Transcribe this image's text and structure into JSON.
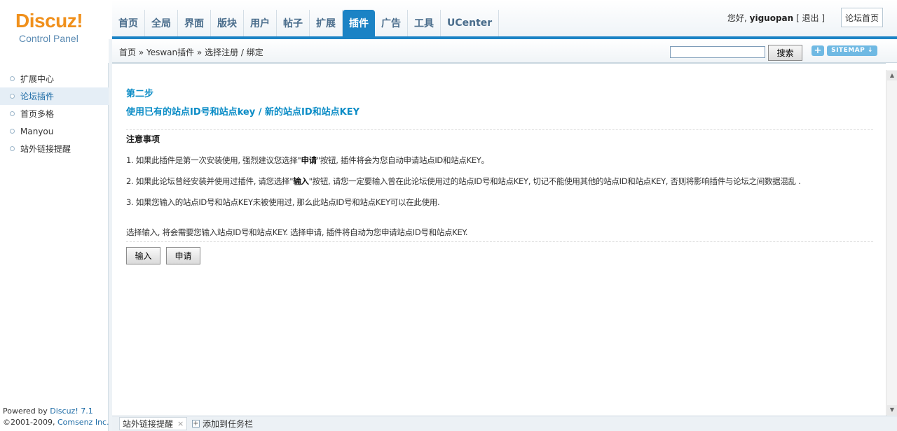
{
  "logo": {
    "brand": "Discuz!",
    "subtitle": "Control Panel"
  },
  "nav": {
    "tabs": [
      {
        "label": "首页"
      },
      {
        "label": "全局"
      },
      {
        "label": "界面"
      },
      {
        "label": "版块"
      },
      {
        "label": "用户"
      },
      {
        "label": "帖子"
      },
      {
        "label": "扩展"
      },
      {
        "label": "插件",
        "active": true
      },
      {
        "label": "广告"
      },
      {
        "label": "工具"
      },
      {
        "label": "UCenter"
      }
    ]
  },
  "user": {
    "greeting": "您好, ",
    "username": "yiguopan",
    "logout_open": " [ ",
    "logout": "退出",
    "logout_close": " ]",
    "home_button": "论坛首页"
  },
  "breadcrumb": "首页 » Yeswan插件 » 选择注册 / 绑定",
  "search": {
    "value": "",
    "button": "搜索",
    "plus": "+",
    "sitemap": "SITEMAP ↓"
  },
  "sidebar": {
    "items": [
      {
        "label": "扩展中心"
      },
      {
        "label": "论坛插件",
        "active": true
      },
      {
        "label": "首页多格"
      },
      {
        "label": "Manyou"
      },
      {
        "label": "站外链接提醒"
      }
    ],
    "footer": {
      "powered_prefix": "Powered by ",
      "powered_link": "Discuz! 7.1",
      "copyright_prefix": "©2001-2009, ",
      "copyright_link": "Comsenz Inc."
    }
  },
  "content": {
    "step_title": "第二步",
    "step_subtitle": "使用已有的站点ID号和站点key / 新的站点ID和站点KEY",
    "notice_title": "注意事项",
    "notice1": {
      "pre": "1. 如果此插件是第一次安装使用, 强烈建议您选择\"",
      "bold": "申请",
      "post": "\"按钮, 插件将会为您自动申请站点ID和站点KEY。"
    },
    "notice2": {
      "pre": "2. 如果此论坛曾经安装并使用过插件, 请您选择\"",
      "bold": "输入",
      "post": "\"按钮, 请您一定要输入曾在此论坛使用过的站点ID号和站点KEY, 切记不能使用其他的站点ID和站点KEY, 否则将影响插件与论坛之间数据混乱 ."
    },
    "notice3": "3. 如果您输入的站点ID号和站点KEY未被使用过, 那么此站点ID号和站点KEY可以在此使用.",
    "summary": "选择输入, 将会需要您输入站点ID号和站点KEY. 选择申请, 插件将自动为您申请站点ID号和站点KEY.",
    "button_input": "输入",
    "button_apply": "申请"
  },
  "taskbar": {
    "item": "站外链接提醒",
    "close": "×",
    "add_icon": "+",
    "add_label": "添加到任务栏"
  }
}
